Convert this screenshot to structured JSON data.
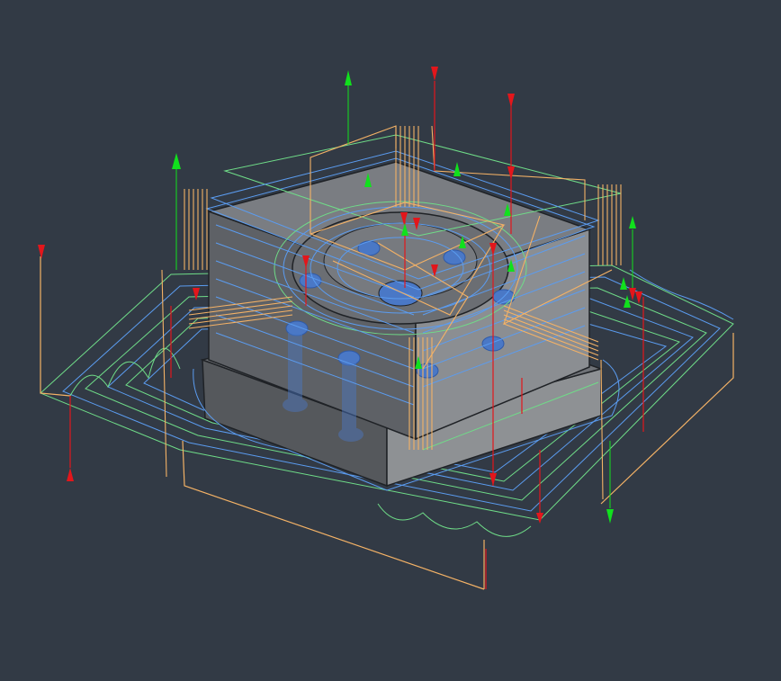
{
  "viewport": {
    "background": "#323a45"
  },
  "colors": {
    "part_top": "#7a7d82",
    "part_side_dark": "#55585c",
    "part_side_light": "#8e9194",
    "edge": "#1f2226",
    "hole": "#4a78c6",
    "hole_dark": "#2f5aa8",
    "cut_blue": "#5b9cf0",
    "cut_green": "#6fdc88",
    "rapid_orange": "#f4b266",
    "plunge_red": "#e3161b",
    "retract_green": "#11e01d"
  },
  "icons": {
    "entry": "down-arrow-icon",
    "exit": "up-arrow-icon"
  }
}
